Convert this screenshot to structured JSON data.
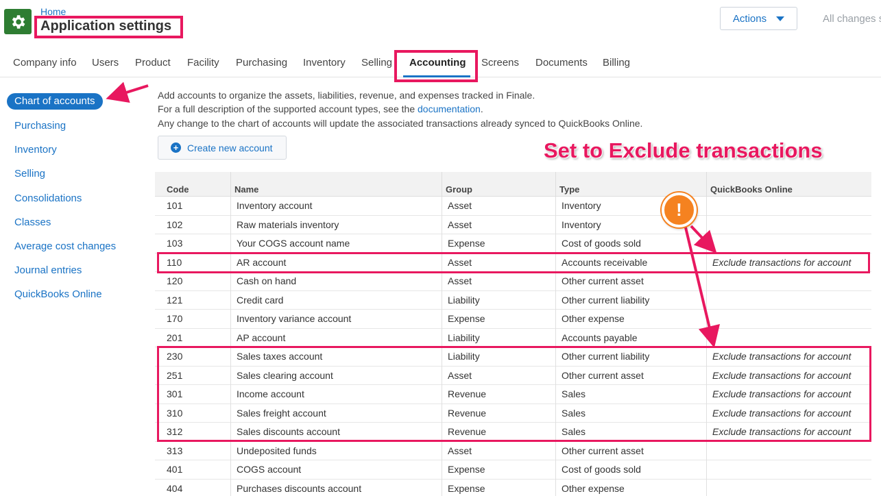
{
  "header": {
    "breadcrumb": "Home",
    "title": "Application settings",
    "actions_label": "Actions",
    "saved_status": "All changes s"
  },
  "tabs": [
    {
      "label": "Company info"
    },
    {
      "label": "Users"
    },
    {
      "label": "Product"
    },
    {
      "label": "Facility"
    },
    {
      "label": "Purchasing"
    },
    {
      "label": "Inventory"
    },
    {
      "label": "Selling"
    },
    {
      "label": "Accounting"
    },
    {
      "label": "Screens"
    },
    {
      "label": "Documents"
    },
    {
      "label": "Billing"
    }
  ],
  "sidebar": {
    "items": [
      {
        "label": "Chart of accounts"
      },
      {
        "label": "Purchasing"
      },
      {
        "label": "Inventory"
      },
      {
        "label": "Selling"
      },
      {
        "label": "Consolidations"
      },
      {
        "label": "Classes"
      },
      {
        "label": "Average cost changes"
      },
      {
        "label": "Journal entries"
      },
      {
        "label": "QuickBooks Online"
      }
    ]
  },
  "intro": {
    "line1": "Add accounts to organize the assets, liabilities, revenue, and expenses tracked in Finale.",
    "line2_prefix": "For a full description of the supported account types, see the ",
    "line2_link": "documentation",
    "line2_suffix": ".",
    "line3": "Any change to the chart of accounts will update the associated transactions already synced to QuickBooks Online."
  },
  "create_button_label": "Create new account",
  "annotation": {
    "title": "Set to Exclude transactions",
    "warn_symbol": "!"
  },
  "table": {
    "columns": [
      "Code",
      "Name",
      "Group",
      "Type",
      "QuickBooks Online"
    ],
    "rows": [
      [
        "101",
        "Inventory account",
        "Asset",
        "Inventory",
        ""
      ],
      [
        "102",
        "Raw materials inventory",
        "Asset",
        "Inventory",
        ""
      ],
      [
        "103",
        "Your COGS account name",
        "Expense",
        "Cost of goods sold",
        ""
      ],
      [
        "110",
        "AR account",
        "Asset",
        "Accounts receivable",
        "Exclude transactions for account"
      ],
      [
        "120",
        "Cash on hand",
        "Asset",
        "Other current asset",
        ""
      ],
      [
        "121",
        "Credit card",
        "Liability",
        "Other current liability",
        ""
      ],
      [
        "170",
        "Inventory variance account",
        "Expense",
        "Other expense",
        ""
      ],
      [
        "201",
        "AP account",
        "Liability",
        "Accounts payable",
        ""
      ],
      [
        "230",
        "Sales taxes account",
        "Liability",
        "Other current liability",
        "Exclude transactions for account"
      ],
      [
        "251",
        "Sales clearing account",
        "Asset",
        "Other current asset",
        "Exclude transactions for account"
      ],
      [
        "301",
        "Income account",
        "Revenue",
        "Sales",
        "Exclude transactions for account"
      ],
      [
        "310",
        "Sales freight account",
        "Revenue",
        "Sales",
        "Exclude transactions for account"
      ],
      [
        "312",
        "Sales discounts account",
        "Revenue",
        "Sales",
        "Exclude transactions for account"
      ],
      [
        "313",
        "Undeposited funds",
        "Asset",
        "Other current asset",
        ""
      ],
      [
        "401",
        "COGS account",
        "Expense",
        "Cost of goods sold",
        ""
      ],
      [
        "404",
        "Purchases discounts account",
        "Expense",
        "Other expense",
        ""
      ]
    ]
  },
  "colors": {
    "accent": "#1a73c5",
    "annotation": "#e8185f",
    "warning": "#f58220",
    "app_icon": "#2e7d32"
  }
}
